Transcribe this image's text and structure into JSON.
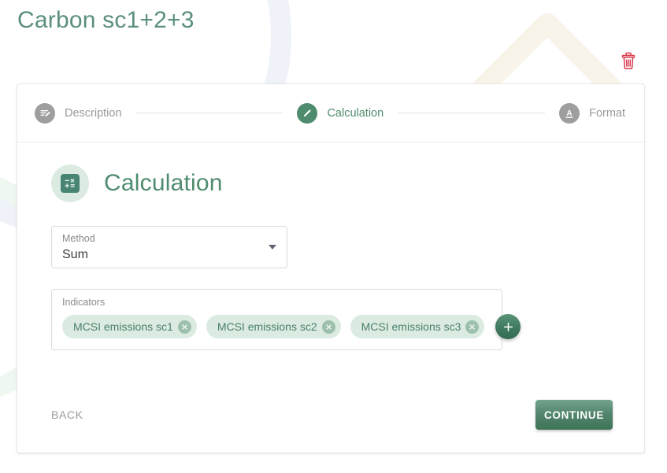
{
  "page": {
    "title": "Carbon sc1+2+3"
  },
  "toolbar": {
    "delete_icon": "trash-icon",
    "delete_color": "#d93b4e"
  },
  "stepper": {
    "steps": [
      {
        "label": "Description",
        "icon": "description-edit-icon",
        "state": "inactive"
      },
      {
        "label": "Calculation",
        "icon": "pencil-icon",
        "state": "active"
      },
      {
        "label": "Format",
        "icon": "format-text-icon",
        "state": "inactive"
      }
    ],
    "active_color": "#4e8c6d",
    "inactive_color": "#9e9e9e"
  },
  "section": {
    "title": "Calculation",
    "icon": "calculator-icon",
    "icon_bg": "#dcebe1",
    "icon_fg": "#478474"
  },
  "method": {
    "label": "Method",
    "value": "Sum",
    "caret_icon": "chevron-down-icon"
  },
  "indicators": {
    "label": "Indicators",
    "chips": [
      {
        "text": "MCSI emissions sc1",
        "remove_icon": "close-circle-icon"
      },
      {
        "text": "MCSI emissions sc2",
        "remove_icon": "close-circle-icon"
      },
      {
        "text": "MCSI emissions sc3",
        "remove_icon": "close-circle-icon"
      }
    ],
    "add_icon": "plus-icon",
    "chip_bg": "#dcebe1",
    "chip_text_color": "#4a7f6a"
  },
  "footer": {
    "back_label": "BACK",
    "continue_label": "CONTINUE",
    "continue_color": "#4e8c6d"
  }
}
